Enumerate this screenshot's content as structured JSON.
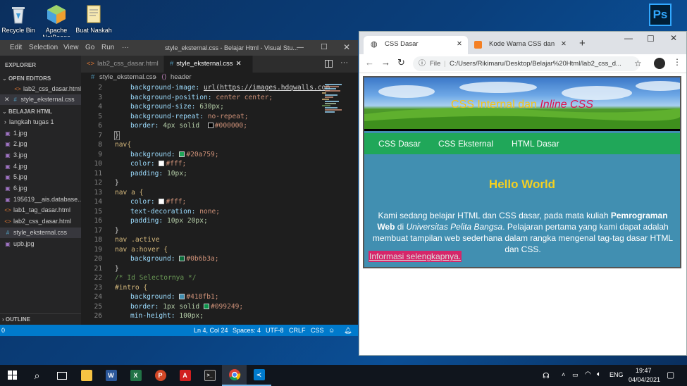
{
  "desktop": {
    "icons": [
      {
        "label": "Recycle Bin",
        "icon": "recycle-bin-icon"
      },
      {
        "label": "Apache NetBeans",
        "icon": "netbeans-icon"
      },
      {
        "label": "Buat Naskah",
        "icon": "document-icon"
      }
    ],
    "ps_icon_text": "Ps"
  },
  "vscode": {
    "menu": [
      "Edit",
      "Selection",
      "View",
      "Go",
      "Run",
      "···"
    ],
    "title": "style_eksternal.css - Belajar Html - Visual Stu...",
    "explorer_label": "EXPLORER",
    "open_editors_label": "OPEN EDITORS",
    "open_editors": [
      "lab2_css_dasar.html",
      "style_eksternal.css"
    ],
    "folder_label": "BELAJAR HTML",
    "files": [
      "langkah tugas 1",
      "1.jpg",
      "2.jpg",
      "3.jpg",
      "4.jpg",
      "5.jpg",
      "6.jpg",
      "195619__ais.database....",
      "lab1_tag_dasar.html",
      "lab2_css_dasar.html",
      "style_eksternal.css",
      "upb.jpg"
    ],
    "outline_label": "OUTLINE",
    "tabs": [
      "lab2_css_dasar.html",
      "style_eksternal.css"
    ],
    "breadcrumb": [
      "style_eksternal.css",
      "header"
    ],
    "line_numbers": [
      "2",
      "3",
      "4",
      "5",
      "6",
      "7",
      "8",
      "9",
      "10",
      "11",
      "12",
      "13",
      "14",
      "15",
      "16",
      "17",
      "18",
      "19",
      "20",
      "21",
      "22",
      "23",
      "24",
      "25",
      "26"
    ],
    "status": {
      "left": "0",
      "position": "Ln 4, Col 24",
      "spaces": "Spaces: 4",
      "encoding": "UTF-8",
      "eol": "CRLF",
      "language": "CSS"
    }
  },
  "code": {
    "l2_prop": "background-image:",
    "l2_val": "url(https://images.hdqwalls.com",
    "l3_prop": "background-position:",
    "l3_val": "center center;",
    "l4_prop": "background-size:",
    "l4_val": "630px;",
    "l5_prop": "background-repeat:",
    "l5_val": "no-repeat;",
    "l6_prop": "border:",
    "l6_val": "4px solid",
    "l6_color": "#000000;",
    "l7": "}",
    "l8": "nav{",
    "l9_prop": "background:",
    "l9_color": "#20a759;",
    "l10_prop": "color:",
    "l10_color": "#fff;",
    "l11_prop": "padding:",
    "l11_val": "10px;",
    "l12": "}",
    "l13": "nav a {",
    "l14_prop": "color:",
    "l14_color": "#fff;",
    "l15_prop": "text-decoration:",
    "l15_val": "none;",
    "l16_prop": "padding:",
    "l16_val": "10px 20px;",
    "l17": "}",
    "l18": "nav .active",
    "l19": "nav a:hover {",
    "l20_prop": "background:",
    "l20_color": "#0b6b3a;",
    "l21": "}",
    "l22": "/* Id Selectornya */",
    "l23": "#intro {",
    "l24_prop": "background:",
    "l24_color": "#418fb1;",
    "l25_prop": "border:",
    "l25_val": "1px solid",
    "l25_color": "#099249;",
    "l26_prop": "min-height:",
    "l26_val": "100px;"
  },
  "swatches": {
    "black": "#000000",
    "green": "#20a759",
    "white": "#ffffff",
    "darkgreen": "#0b6b3a",
    "blue": "#418fb1",
    "green2": "#099249"
  },
  "chrome": {
    "tabs": [
      {
        "title": "CSS Dasar",
        "active": true
      },
      {
        "title": "Kode Warna CSS dan HTML",
        "active": false
      }
    ],
    "new_tab": "+",
    "url_prefix": "File",
    "url": "C:/Users/Rikimaru/Desktop/Belajar%20Html/lab2_css_d...",
    "page": {
      "banner_title_plain": "CSS Internal dan",
      "banner_title_italic": "Inline CSS",
      "nav": [
        "CSS Dasar",
        "CSS Eksternal",
        "HTML Dasar"
      ],
      "heading": "Hello World",
      "para_1": "Kami sedang belajar HTML dan CSS dasar, pada mata kuliah",
      "para_bold": "Pemrograman Web",
      "para_2": "di",
      "para_italic": "Universitas Pelita Bangsa",
      "para_3": ". Pelajaran pertama yang kami dapat adalah membuat tampilan web sederhana dalam rangka mengenal tag-tag dasar HTML dan CSS.",
      "link": "Informasi selengkapnya."
    }
  },
  "taskbar": {
    "language": "ENG",
    "time": "19:47",
    "date": "04/04/2021"
  }
}
